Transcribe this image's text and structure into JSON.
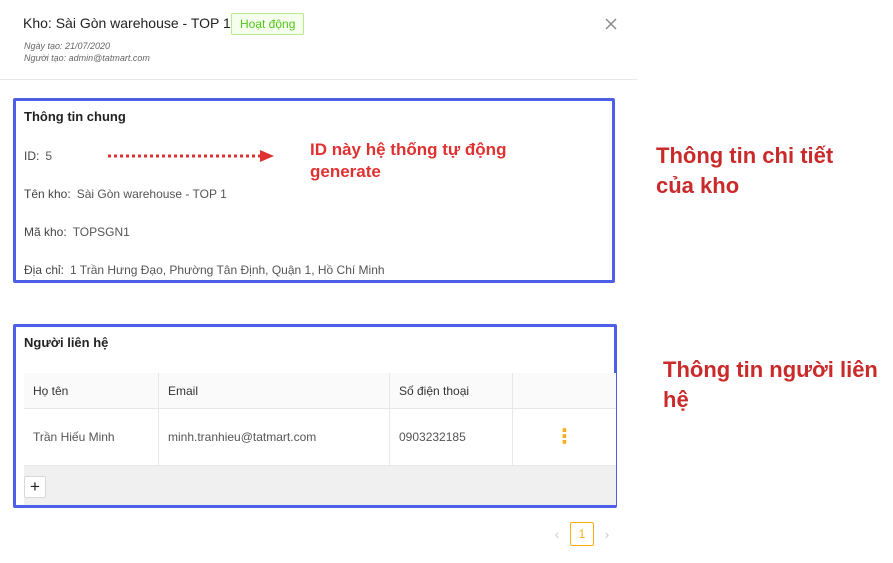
{
  "header": {
    "title": "Kho: Sài Gòn warehouse - TOP 1",
    "status": "Hoạt động",
    "created_date": "Ngày tạo: 21/07/2020",
    "created_by": "Người tạo: admin@tatmart.com"
  },
  "general": {
    "title": "Thông tin chung",
    "id_label": "ID:",
    "id_value": "5",
    "name_label": "Tên kho:",
    "name_value": "Sài Gòn warehouse - TOP 1",
    "code_label": "Mã kho:",
    "code_value": "TOPSGN1",
    "address_label": "Địa chỉ:",
    "address_value": "1 Trần Hưng Đạo, Phường Tân Định, Quận 1, Hồ Chí Minh",
    "id_note": "ID này hệ thống tự động generate"
  },
  "contacts": {
    "title": "Người liên hệ",
    "columns": [
      "Họ tên",
      "Email",
      "Số điện thoại"
    ],
    "rows": [
      {
        "name": "Trần Hiếu Minh",
        "email": "minh.tranhieu@tatmart.com",
        "phone": "0903232185",
        "actions": "⋮"
      }
    ],
    "add_label": "+"
  },
  "annotations": {
    "detail": "Thông tin chi tiết của kho",
    "contact": "Thông tin người liên hệ"
  },
  "pagination": {
    "current": "1",
    "prev": "‹",
    "next": "›"
  },
  "icons": {
    "close": "close-icon",
    "kebab": "more-vertical-icon",
    "arrow": "dotted-arrow-right-icon"
  },
  "colors": {
    "accent_border": "#4d5fe6",
    "status_green": "#52c41a",
    "annotation_red": "#c92a2a",
    "page_active": "#faad14"
  }
}
